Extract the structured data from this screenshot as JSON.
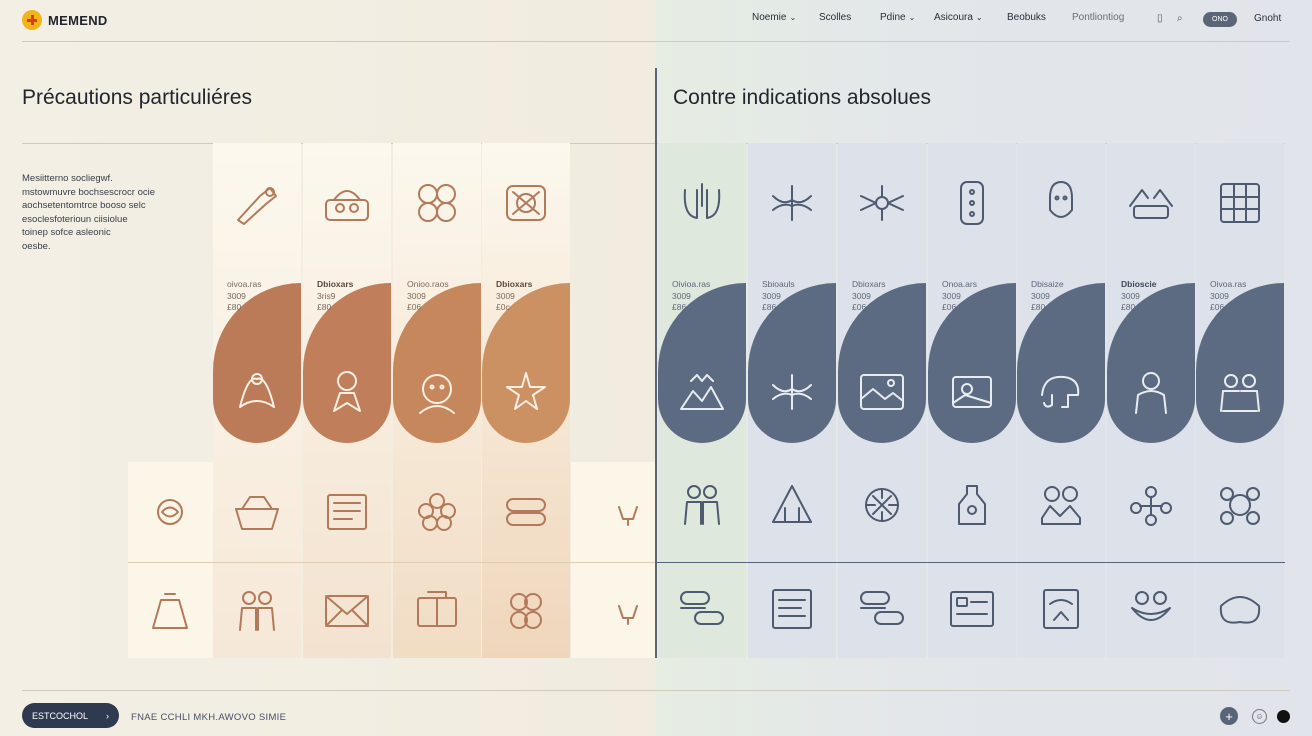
{
  "header": {
    "brand": "MEMEND",
    "nav": [
      {
        "label": "Noemie",
        "chevron": true
      },
      {
        "label": "Scolles",
        "chevron": false
      },
      {
        "label": "Pdine",
        "chevron": true
      },
      {
        "label": "Asicoura",
        "chevron": true
      },
      {
        "label": "Beobuks",
        "chevron": false
      },
      {
        "label": "Pontliontiog",
        "chevron": false
      }
    ],
    "toggle_label": "ONO",
    "account_label": "Gnoht"
  },
  "left_section": {
    "title": "Précautions particuliéres",
    "description": [
      "Mesiitterno socliegwf.",
      "mstowmuvre bochsescrocr ocie",
      "aochsetentomtrce booso selc",
      "esoclesfoterioun ciisiolue",
      "toinep sofce asleonic",
      "oesbe."
    ],
    "blob_labels": [
      {
        "lines": [
          "oivoa.ras",
          "3009",
          "£80"
        ],
        "bold": false
      },
      {
        "lines": [
          "Dbioxars",
          "3ris9",
          "£80"
        ],
        "bold": true
      },
      {
        "lines": [
          "Onioo.raos",
          "3009",
          "£06"
        ],
        "bold": false
      },
      {
        "lines": [
          "Dbioxars",
          "3009",
          "£0c"
        ],
        "bold": true
      }
    ]
  },
  "right_section": {
    "title": "Contre indications absolues",
    "blob_labels": [
      {
        "lines": [
          "Oivioa.ras",
          "3009",
          "£86"
        ],
        "bold": false
      },
      {
        "lines": [
          "Sbioauls",
          "3009",
          "£86"
        ],
        "bold": false
      },
      {
        "lines": [
          "Dbioxars",
          "3009",
          "£06"
        ],
        "bold": false
      },
      {
        "lines": [
          "Onoa.ars",
          "3009",
          "£06"
        ],
        "bold": false
      },
      {
        "lines": [
          "Dbisaize",
          "3009",
          "£80"
        ],
        "bold": false
      },
      {
        "lines": [
          "Dbioscie",
          "3009",
          "£80"
        ],
        "bold": true
      },
      {
        "lines": [
          "Oivoa.ras",
          "3009",
          "£06"
        ],
        "bold": false
      }
    ]
  },
  "footer": {
    "button_label": "ESTCOCHOL",
    "text": "FNAE CCHLI MKH.AWOVO SIMIE"
  },
  "colors": {
    "accent_warm": "#b97a56",
    "accent_cool": "#5b6b82",
    "line_warm": "#b88a6a",
    "line_cool": "#5a6478"
  },
  "icons": {
    "left_top": [
      "arm-icon",
      "basket-icon",
      "circles-cluster-icon",
      "box-pattern-icon"
    ],
    "left_blob": [
      "hands-icon",
      "child-icon",
      "face-icon",
      "star-burst-icon"
    ],
    "left_row1": [
      "brain-icon",
      "bowl-icon",
      "document-icon",
      "flower-icon",
      "pillows-icon",
      "small-figure-icon"
    ],
    "left_row2": [
      "sack-icon",
      "couple-icon",
      "envelope-icon",
      "book-icon",
      "rings-icon",
      "small-figure-icon"
    ],
    "right_top": [
      "lungs-icon",
      "mosquito-icon",
      "insect-icon",
      "phone-icon",
      "face-outline-icon",
      "hands-group-icon",
      "grid-pattern-icon"
    ],
    "right_blob": [
      "crown-mountain-icon",
      "mosquito-icon",
      "image-card-icon",
      "photo-icon",
      "elephant-icon",
      "person-icon",
      "figures-icon"
    ],
    "right_row1": [
      "couple-icon",
      "triangle-people-icon",
      "virus-icon",
      "bottle-icon",
      "people-icon",
      "network-icon",
      "cluster-icon"
    ],
    "right_row2": [
      "pills-icon",
      "list-card-icon",
      "pills-icon",
      "form-card-icon",
      "sign-card-icon",
      "frog-icon",
      "bean-icon"
    ]
  }
}
